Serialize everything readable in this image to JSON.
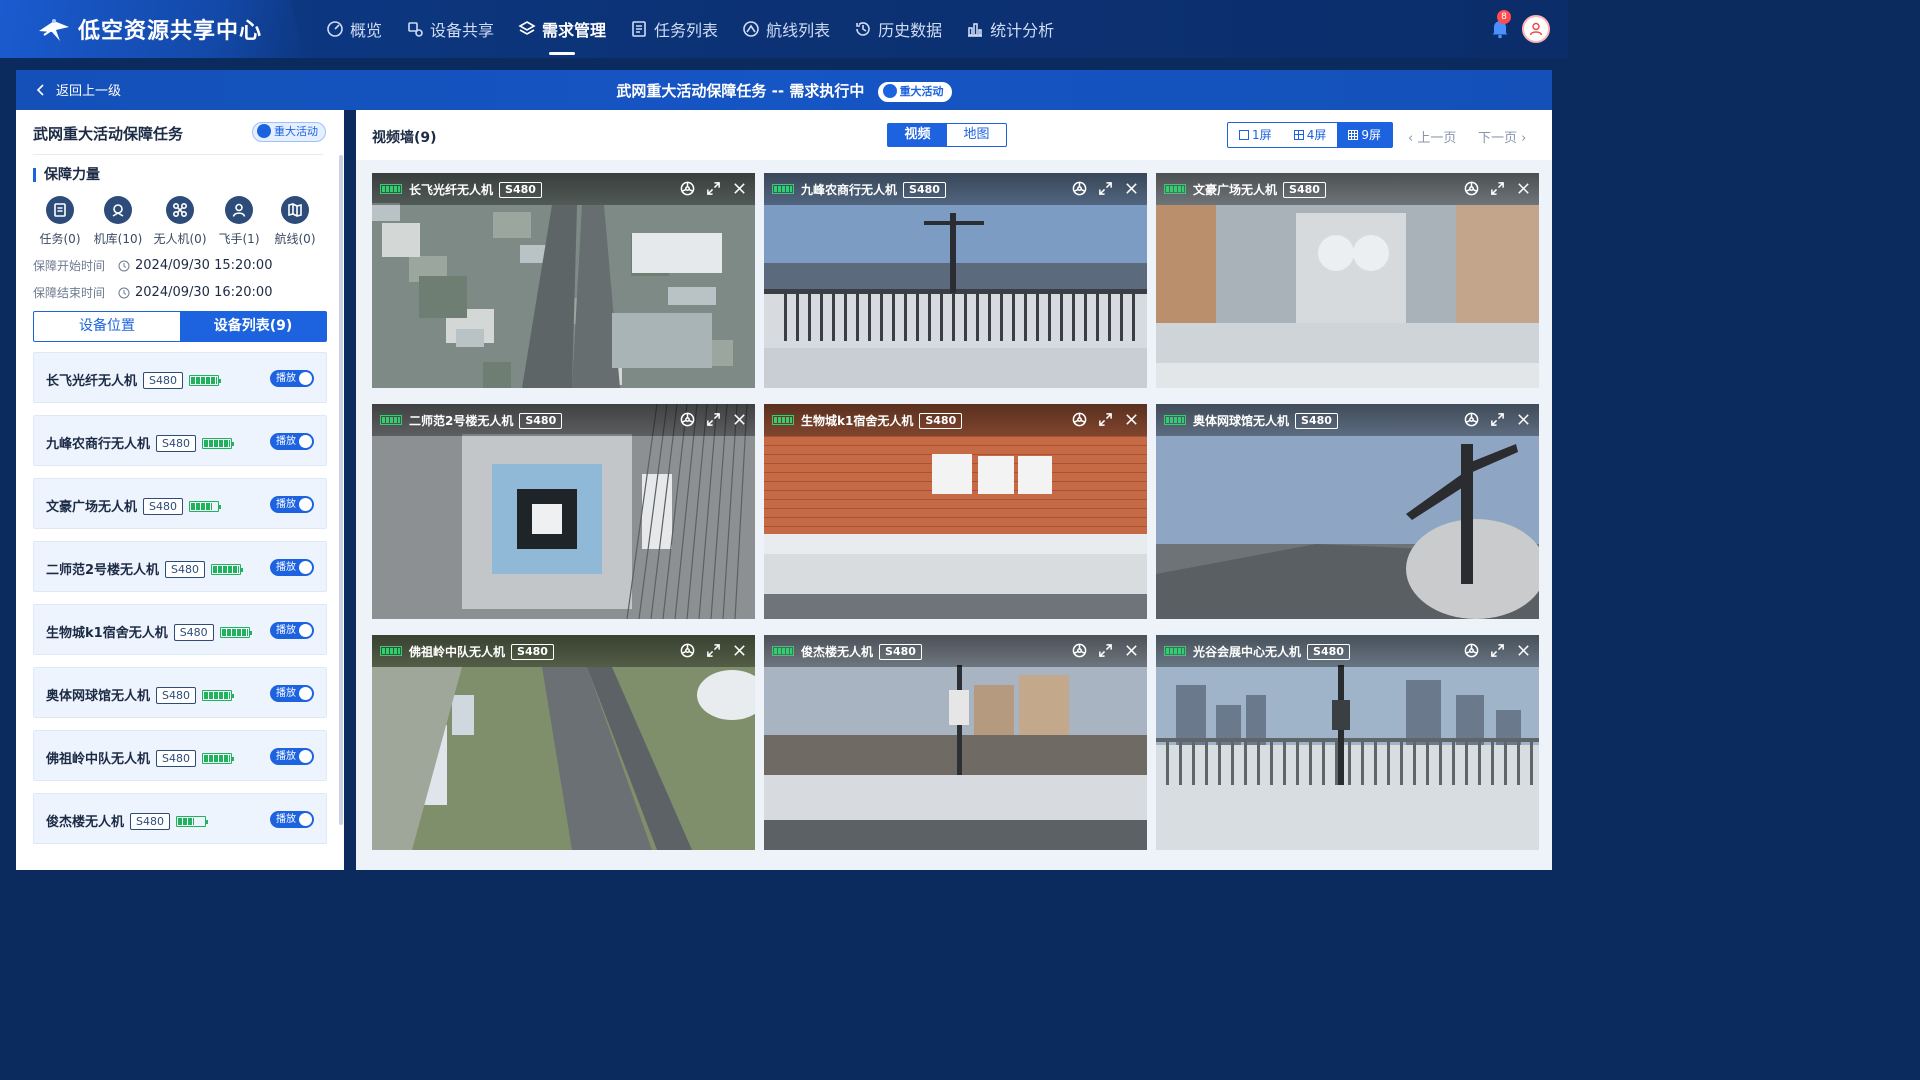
{
  "app": {
    "title": "低空资源共享中心"
  },
  "nav": [
    {
      "label": "概览",
      "icon": "dashboard-icon",
      "active": false
    },
    {
      "label": "设备共享",
      "icon": "share-icon",
      "active": false
    },
    {
      "label": "需求管理",
      "icon": "layers-icon",
      "active": true
    },
    {
      "label": "任务列表",
      "icon": "list-icon",
      "active": false
    },
    {
      "label": "航线列表",
      "icon": "route-icon",
      "active": false
    },
    {
      "label": "历史数据",
      "icon": "history-icon",
      "active": false
    },
    {
      "label": "统计分析",
      "icon": "chart-icon",
      "active": false
    }
  ],
  "notifications": {
    "count": "8"
  },
  "header": {
    "back_label": "返回上一级",
    "task_title": "武网重大活动保障任务 -- 需求执行中",
    "task_tag": "重大活动"
  },
  "left": {
    "title": "武网重大活动保障任务",
    "tag": "重大活动",
    "section_title": "保障力量",
    "stats": [
      {
        "label": "任务(0)",
        "icon": "task-icon"
      },
      {
        "label": "机库(10)",
        "icon": "hangar-icon"
      },
      {
        "label": "无人机(0)",
        "icon": "drone-icon"
      },
      {
        "label": "飞手(1)",
        "icon": "pilot-icon"
      },
      {
        "label": "航线(0)",
        "icon": "map-icon"
      }
    ],
    "start_label": "保障开始时间",
    "start_time": "2024/09/30 15:20:00",
    "end_label": "保障结束时间",
    "end_time": "2024/09/30 16:20:00",
    "tabs": {
      "location": "设备位置",
      "list": "设备列表(9)"
    },
    "play_label": "播放",
    "devices": [
      {
        "name": "长飞光纤无人机",
        "model": "S480",
        "battery": 1.0
      },
      {
        "name": "九峰农商行无人机",
        "model": "S480",
        "battery": 1.0
      },
      {
        "name": "文豪广场无人机",
        "model": "S480",
        "battery": 0.8
      },
      {
        "name": "二师范2号楼无人机",
        "model": "S480",
        "battery": 1.0
      },
      {
        "name": "生物城k1宿舍无人机",
        "model": "S480",
        "battery": 1.0
      },
      {
        "name": "奥体网球馆无人机",
        "model": "S480",
        "battery": 1.0
      },
      {
        "name": "佛祖岭中队无人机",
        "model": "S480",
        "battery": 1.0
      },
      {
        "name": "俊杰楼无人机",
        "model": "S480",
        "battery": 0.6
      }
    ]
  },
  "right": {
    "wall_title": "视频墙(9)",
    "view_toggle": {
      "video": "视频",
      "map": "地图"
    },
    "screens": {
      "one": "1屏",
      "four": "4屏",
      "nine": "9屏"
    },
    "prev": "上一页",
    "next": "下一页",
    "tiles": [
      {
        "name": "长飞光纤无人机",
        "model": "S480",
        "scene": "aerial-road"
      },
      {
        "name": "九峰农商行无人机",
        "model": "S480",
        "scene": "rooftop-sky"
      },
      {
        "name": "文豪广场无人机",
        "model": "S480",
        "scene": "rooftop-city"
      },
      {
        "name": "二师范2号楼无人机",
        "model": "S480",
        "scene": "landing-pad"
      },
      {
        "name": "生物城k1宿舍无人机",
        "model": "S480",
        "scene": "brick-wall"
      },
      {
        "name": "奥体网球馆无人机",
        "model": "S480",
        "scene": "rooftop-tank"
      },
      {
        "name": "佛祖岭中队无人机",
        "model": "S480",
        "scene": "aerial-highway"
      },
      {
        "name": "俊杰楼无人机",
        "model": "S480",
        "scene": "rooftop-skyline"
      },
      {
        "name": "光谷会展中心无人机",
        "model": "S480",
        "scene": "rooftop-towers"
      }
    ]
  },
  "colors": {
    "primary": "#1d63e0",
    "nav_bg": "#0c3377",
    "battery": "#21b25d",
    "badge": "#ff4d4f"
  }
}
